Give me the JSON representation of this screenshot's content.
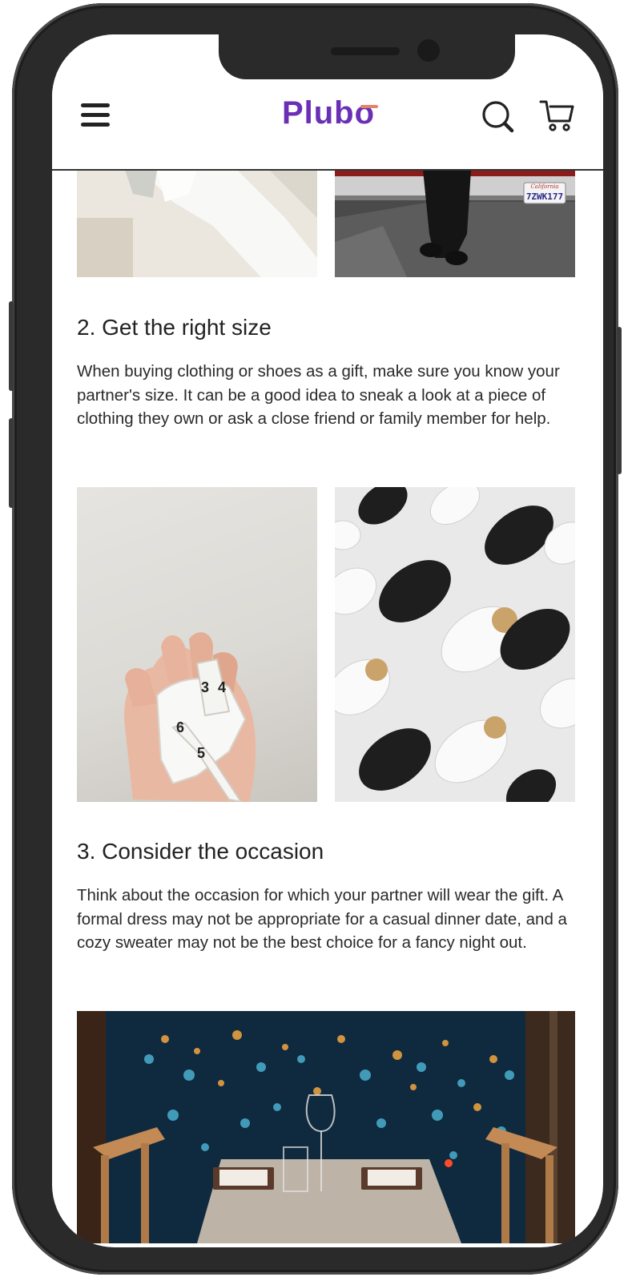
{
  "header": {
    "logo_text": "Plubo",
    "menu_icon": "hamburger-menu-icon",
    "search_icon": "search-icon",
    "cart_icon": "shopping-cart-icon"
  },
  "sections": [
    {
      "heading": "2. Get the right size",
      "body": "When buying clothing or shoes as a gift, make sure you know your partner's size. It can be a good idea to sneak a look at a piece of clothing they own or ask a close friend or family member for help."
    },
    {
      "heading": "3. Consider the occasion",
      "body": "Think about the occasion for which your partner will wear the gift. A formal dress may not be appropriate for a casual dinner date, and a cozy sweater may not be the best choice for a fancy night out."
    }
  ],
  "images": {
    "plate_text_state": "California",
    "plate_text_number": "7ZWK177",
    "tape_numbers": [
      "6",
      "5",
      "3",
      "4"
    ]
  },
  "colors": {
    "brand_purple": "#6a2fb5",
    "brand_accent": "#e2826a",
    "phone_frame": "#2a2a2a"
  }
}
